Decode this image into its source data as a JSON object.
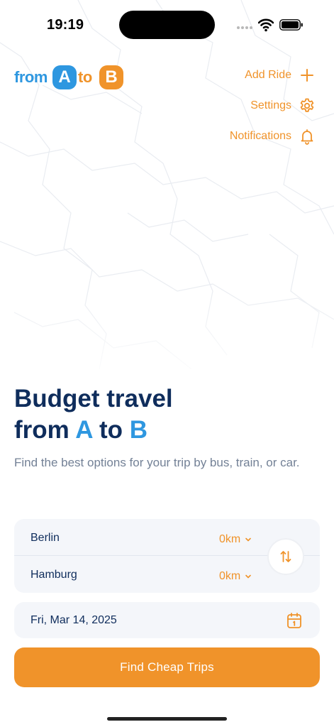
{
  "status_bar": {
    "time": "19:19"
  },
  "logo": {
    "from": "from",
    "a": "A",
    "to": "to",
    "b": "B"
  },
  "menu": {
    "add_ride": "Add Ride",
    "settings": "Settings",
    "notifications": "Notifications"
  },
  "hero": {
    "title_line1": "Budget travel",
    "title_from": "from",
    "title_a": "A",
    "title_to": "to",
    "title_b": "B",
    "subtitle": "Find the best options for your trip by bus, train, or car."
  },
  "route": {
    "origin": {
      "city": "Berlin",
      "radius": "0km"
    },
    "destination": {
      "city": "Hamburg",
      "radius": "0km"
    }
  },
  "date": {
    "value": "Fri, Mar 14, 2025"
  },
  "cta": {
    "label": "Find Cheap Trips"
  },
  "colors": {
    "accent": "#f0932a",
    "brand_blue": "#2e97e0",
    "navy": "#0f2d5c",
    "muted": "#738196"
  },
  "icons": [
    "plus-icon",
    "gear-icon",
    "bell-icon",
    "chevron-down-icon",
    "swap-arrows-icon",
    "calendar-icon",
    "wifi-icon",
    "battery-icon"
  ]
}
